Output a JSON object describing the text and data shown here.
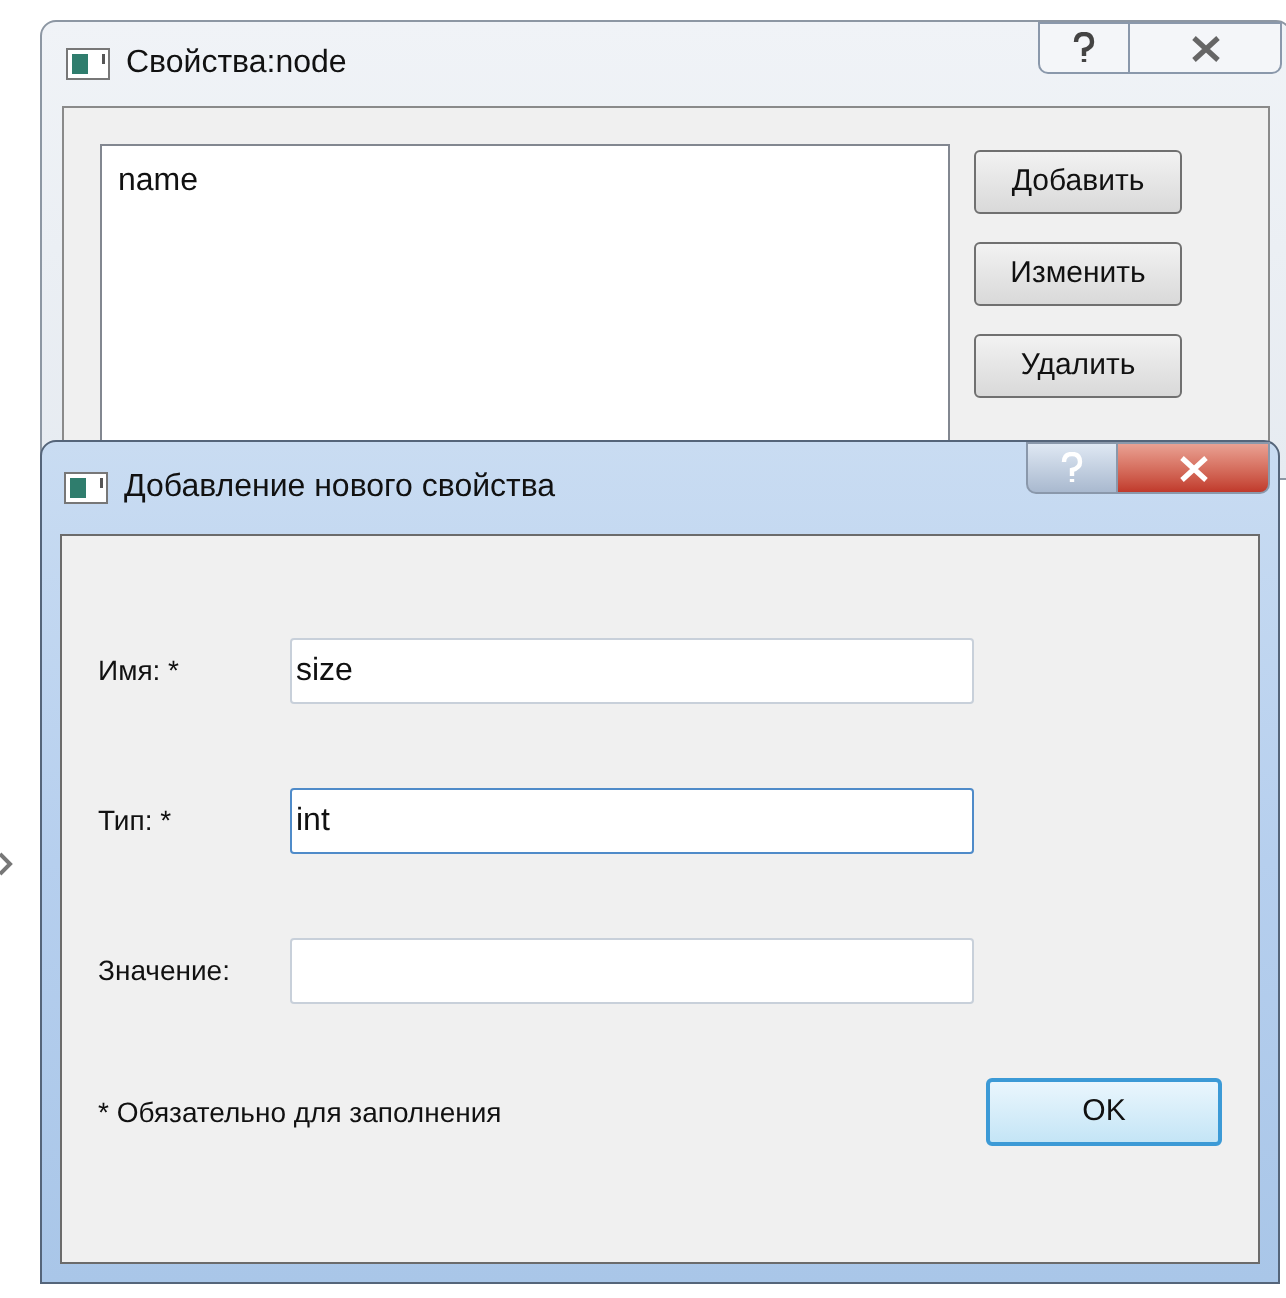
{
  "properties_window": {
    "title": "Свойства:node",
    "active": false,
    "list_items": [
      "name"
    ],
    "buttons": [
      "Добавить",
      "Изменить",
      "Удалить"
    ]
  },
  "add_property_dialog": {
    "title": "Добавление нового свойства",
    "active": true,
    "fields": [
      {
        "label": "Имя: *",
        "value": "size",
        "focused": false
      },
      {
        "label": "Тип: *",
        "value": "int",
        "focused": true
      },
      {
        "label": "Значение:",
        "focused": false
      }
    ],
    "note": "* Обязательно для заполнения",
    "ok_button": "OK"
  }
}
